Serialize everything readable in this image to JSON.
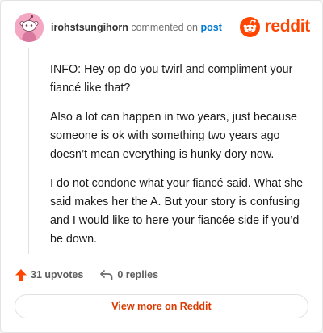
{
  "header": {
    "username": "irohstsungihorn",
    "action_text": "commented on",
    "post_link": "post",
    "logo_text": "reddit"
  },
  "comment": {
    "paragraphs": [
      "INFO: Hey op do you twirl and compliment your fiancé like that?",
      "Also a lot can happen in two years, just because someone is ok with something two years ago doesn’t mean everything is hunky dory now.",
      "I do not condone what your fiancé said. What she said makes her the A. But your story is confusing and I would like to here your fiancée side if you’d be down."
    ]
  },
  "actions": {
    "upvotes_label": "31 upvotes",
    "replies_label": "0 replies"
  },
  "footer": {
    "view_more_label": "View more on Reddit"
  },
  "icons": {
    "avatar": "snoo-avatar-icon",
    "logo": "reddit-logo-icon",
    "upvote": "upvote-arrow-icon",
    "reply": "reply-arrow-icon"
  },
  "colors": {
    "brand": "#ff4500",
    "upvote": "#ff4500",
    "link": "#0079d3",
    "view_more_text": "#d93a00",
    "avatar_bg": "#f4a7c3"
  }
}
